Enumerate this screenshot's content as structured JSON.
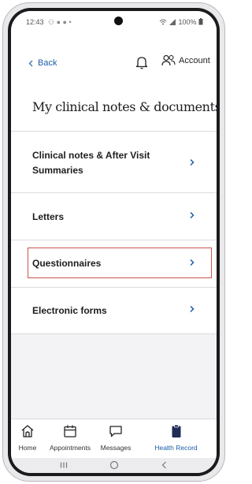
{
  "status": {
    "time": "12:43",
    "indicators": "⚇ ● ● •",
    "battery": "100%"
  },
  "header": {
    "back_label": "Back",
    "account_label": "Account",
    "icons": [
      "bell-icon",
      "account-icon"
    ]
  },
  "page": {
    "title": "My clinical notes & documents"
  },
  "list": {
    "items": [
      {
        "line1": "Clinical notes & After Visit",
        "line2": "Summaries"
      },
      {
        "line1": "Letters"
      },
      {
        "line1": "Questionnaires"
      },
      {
        "line1": "Electronic forms"
      }
    ]
  },
  "tabs": [
    {
      "label": "Home",
      "icon": "home-icon"
    },
    {
      "label": "Appointments",
      "icon": "calendar-icon"
    },
    {
      "label": "Messages",
      "icon": "message-icon"
    },
    {
      "label": "Health Record",
      "icon": "clipboard-icon"
    }
  ],
  "colors": {
    "accent": "#1a5fa8",
    "highlight_border": "#c9544c"
  }
}
